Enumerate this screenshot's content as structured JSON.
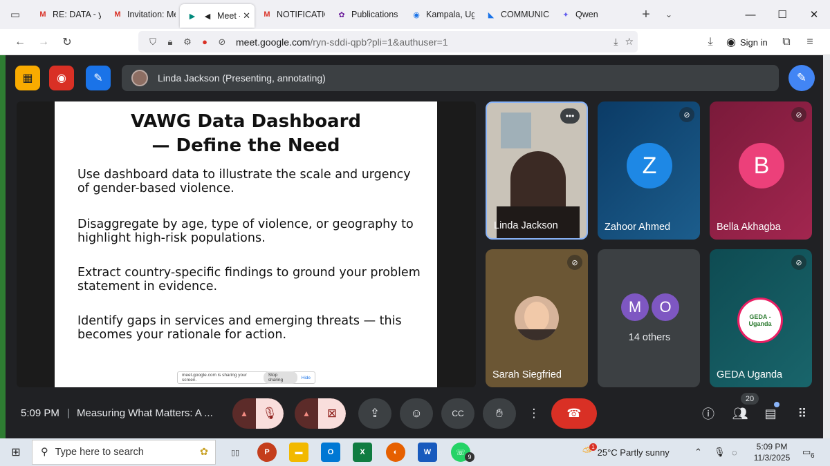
{
  "browser": {
    "tabs": [
      {
        "title": "RE: DATA - yb",
        "icon": "gmail-icon",
        "color": "#d93025"
      },
      {
        "title": "Invitation: Me",
        "icon": "gmail-icon",
        "color": "#d93025"
      },
      {
        "title": "Meet -",
        "icon": "meet-icon",
        "color": "#00897b",
        "active": true
      },
      {
        "title": "NOTIFICATIOI",
        "icon": "gmail-icon",
        "color": "#d93025"
      },
      {
        "title": "Publications -",
        "icon": "publications-icon",
        "color": "#6a1b9a"
      },
      {
        "title": "Kampala, Uga",
        "icon": "chrome-icon",
        "color": "#1a73e8"
      },
      {
        "title": "COMMUNICA",
        "icon": "docs-icon",
        "color": "#1a73e8"
      },
      {
        "title": "Qwen",
        "icon": "qwen-icon",
        "color": "#615ced"
      }
    ],
    "url_host": "meet.google.com",
    "url_path": "/ryn-sddi-qpb?pli=1&authuser=1",
    "sign_in": "Sign in"
  },
  "meet": {
    "presenter_label": "Linda Jackson (Presenting, annotating)",
    "slide": {
      "title_line1": "VAWG Data Dashboard",
      "title_line2": "— Define the Need",
      "bullets": [
        "Use dashboard data to illustrate the scale and urgency of gender-based violence.",
        "Disaggregate by age, type of violence, or geography to highlight high-risk populations.",
        "Extract country-specific findings to ground your problem statement in evidence.",
        "Identify gaps in services and emerging threats — this becomes your rationale for action."
      ]
    },
    "share_bar": {
      "text": "meet.google.com is sharing your screen.",
      "stop": "Stop sharing",
      "hide": "Hide"
    },
    "participants": [
      {
        "name": "Linda Jackson",
        "type": "video"
      },
      {
        "name": "Zahoor Ahmed",
        "initial": "Z",
        "color": "#1e88e5",
        "muted": true
      },
      {
        "name": "Bella Akhagba",
        "initial": "B",
        "color": "#ec407a",
        "muted": true
      },
      {
        "name": "Sarah Siegfried",
        "type": "photo",
        "muted": true
      },
      {
        "others_label": "14 others",
        "initials": [
          "M",
          "O"
        ]
      },
      {
        "name": "GEDA Uganda",
        "type": "logo",
        "logo_text": "GEDA - Uganda",
        "muted": true
      }
    ],
    "bottom": {
      "time": "5:09 PM",
      "meeting_title": "Measuring What Matters: A ...",
      "people_count": "20"
    }
  },
  "taskbar": {
    "search_placeholder": "Type here to search",
    "weather": "25°C  Partly sunny",
    "time": "5:09 PM",
    "date": "11/3/2025",
    "notifications": "6",
    "whatsapp_badge": "9",
    "weather_badge": "1"
  }
}
